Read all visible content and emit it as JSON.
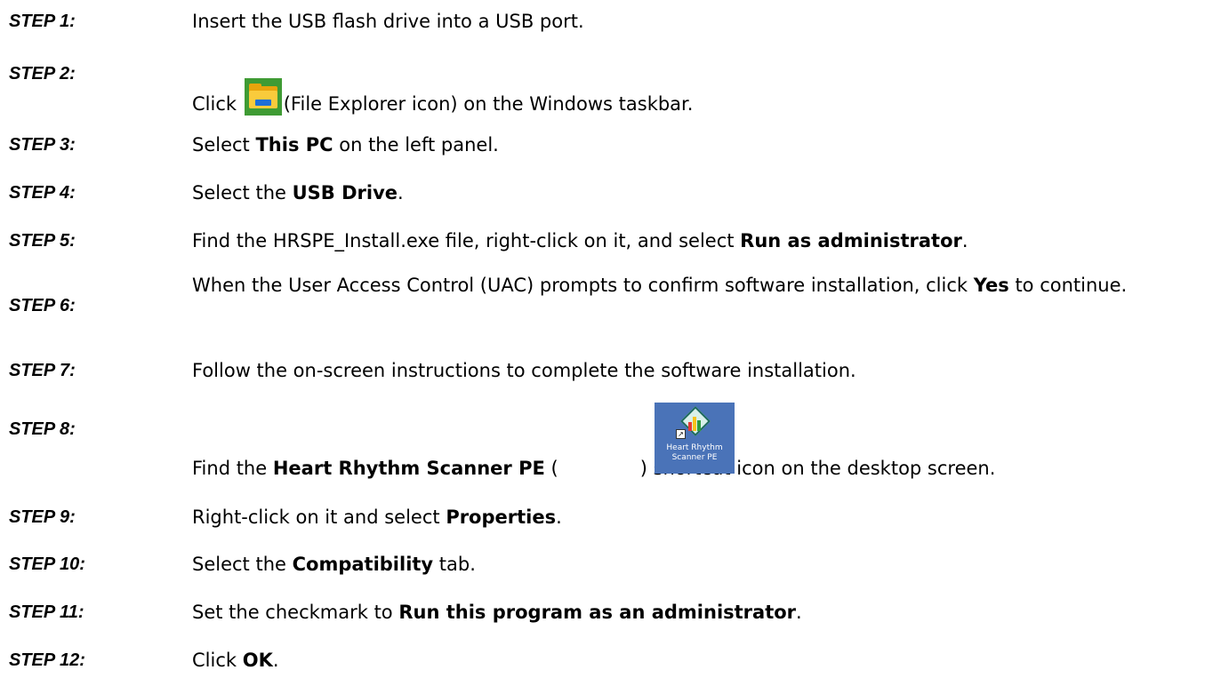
{
  "steps": [
    {
      "label": "STEP 1:",
      "text": "Insert the USB flash drive into a USB port."
    },
    {
      "label": "STEP 2:",
      "pre": "Click",
      "post": "(File Explorer icon) on the Windows taskbar.",
      "icon": "file-explorer-icon"
    },
    {
      "label": "STEP 3:",
      "pre": "Select ",
      "bold": "This PC",
      "post": " on the left panel."
    },
    {
      "label": "STEP 4:",
      "pre": "Select the ",
      "bold": "USB Drive",
      "post": "."
    },
    {
      "label": "STEP 5:",
      "pre": "Find the HRSPE_Install.exe file, right-click on it, and select ",
      "bold": "Run as administrator",
      "post": "."
    },
    {
      "label": "STEP 6:",
      "pre": "When the User Access Control (UAC) prompts to confirm software installation, click ",
      "bold": "Yes",
      "post": " to continue."
    },
    {
      "label": "STEP 7:",
      "text": "Follow the on-screen instructions to complete the software installation."
    },
    {
      "label": "STEP 8:",
      "pre": "Find the ",
      "bold": "Heart Rhythm Scanner PE",
      "mid": " (",
      "post": ") shortcut icon on the desktop screen.",
      "icon": "heart-rhythm-scanner-shortcut-icon",
      "icon_caption": "Heart Rhythm\nScanner PE"
    },
    {
      "label": "STEP 9:",
      "pre": "Right-click on it and select ",
      "bold": "Properties",
      "post": "."
    },
    {
      "label": "STEP 10:",
      "pre": "Select the ",
      "bold": "Compatibility",
      "post": " tab."
    },
    {
      "label": "STEP 11:",
      "pre": "Set the checkmark to ",
      "bold": "Run this program as an administrator",
      "post": "."
    },
    {
      "label": "STEP 12:",
      "pre": "Click ",
      "bold": "OK",
      "post": "."
    }
  ],
  "colors": {
    "file_explorer_bg": "#3f9b34",
    "folder": "#f9cb3c",
    "shortcut_bg": "#4a73b8"
  }
}
